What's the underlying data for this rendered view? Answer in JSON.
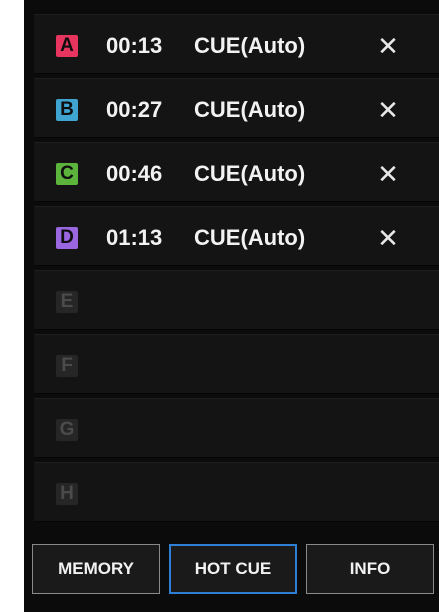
{
  "cues": [
    {
      "letter": "A",
      "color": "#e8355f",
      "time": "00:13",
      "label": "CUE(Auto)",
      "delete": "✕"
    },
    {
      "letter": "B",
      "color": "#3fa4cf",
      "time": "00:27",
      "label": "CUE(Auto)",
      "delete": "✕"
    },
    {
      "letter": "C",
      "color": "#5db43c",
      "time": "00:46",
      "label": "CUE(Auto)",
      "delete": "✕"
    },
    {
      "letter": "D",
      "color": "#9a67e0",
      "time": "01:13",
      "label": "CUE(Auto)",
      "delete": "✕"
    },
    {
      "letter": "E"
    },
    {
      "letter": "F"
    },
    {
      "letter": "G"
    },
    {
      "letter": "H"
    }
  ],
  "tabs": {
    "memory": "MEMORY",
    "hot_cue": "HOT CUE",
    "info": "INFO",
    "active": "hot_cue"
  },
  "icons": {
    "delete": "close-icon"
  }
}
